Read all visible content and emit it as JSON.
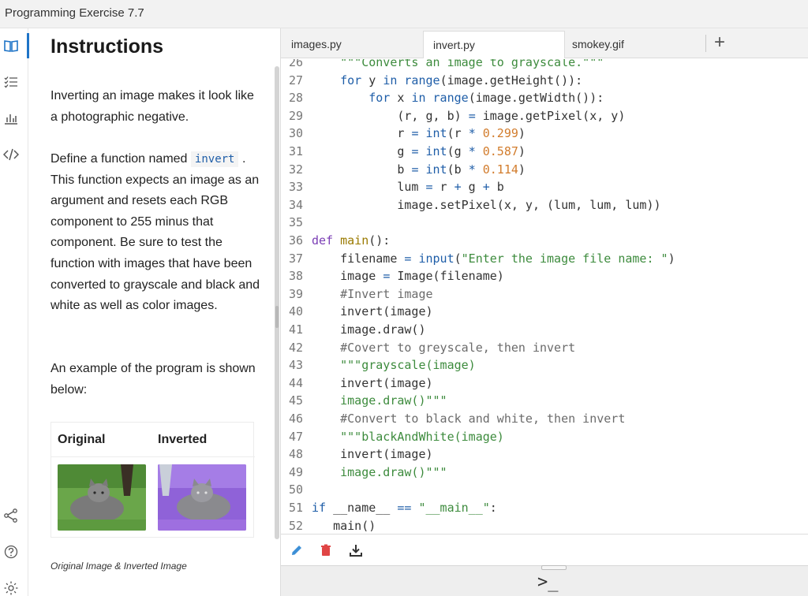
{
  "window": {
    "title": "Programming Exercise 7.7"
  },
  "rail": {
    "icons": [
      "book-icon",
      "checklist-icon",
      "chart-icon",
      "code-icon",
      "share-icon",
      "help-icon",
      "settings-icon"
    ]
  },
  "instructions": {
    "heading": "Instructions",
    "para1": "Inverting an image makes it look like a photographic negative.",
    "para2_prefix": "Define a function named",
    "para2_code": "invert",
    "para2_rest": ". This function expects an image as an argument and resets each RGB component to 255 minus that component. Be sure to test the function with images that have been converted to grayscale and black and white as well as color images.",
    "para3": "An example of the program is shown below:",
    "table": {
      "col1": "Original",
      "col2": "Inverted"
    },
    "caption": "Original Image & Inverted Image"
  },
  "tabs": [
    {
      "label": "images.py",
      "active": false
    },
    {
      "label": "invert.py",
      "active": true
    },
    {
      "label": "smokey.gif",
      "active": false
    }
  ],
  "tab_add_label": "+",
  "code": {
    "lines": [
      {
        "n": "26",
        "text": "    \"\"\"Converts an image to grayscale.\"\"\""
      },
      {
        "n": "27",
        "text": "    for y in range(image.getHeight()):"
      },
      {
        "n": "28",
        "text": "        for x in range(image.getWidth()):"
      },
      {
        "n": "29",
        "text": "            (r, g, b) = image.getPixel(x, y)"
      },
      {
        "n": "30",
        "text": "            r = int(r * 0.299)"
      },
      {
        "n": "31",
        "text": "            g = int(g * 0.587)"
      },
      {
        "n": "32",
        "text": "            b = int(b * 0.114)"
      },
      {
        "n": "33",
        "text": "            lum = r + g + b"
      },
      {
        "n": "34",
        "text": "            image.setPixel(x, y, (lum, lum, lum))"
      },
      {
        "n": "35",
        "text": ""
      },
      {
        "n": "36",
        "text": "def main():"
      },
      {
        "n": "37",
        "text": "    filename = input(\"Enter the image file name: \")"
      },
      {
        "n": "38",
        "text": "    image = Image(filename)"
      },
      {
        "n": "39",
        "text": "    #Invert image"
      },
      {
        "n": "40",
        "text": "    invert(image)"
      },
      {
        "n": "41",
        "text": "    image.draw()"
      },
      {
        "n": "42",
        "text": "    #Covert to greyscale, then invert"
      },
      {
        "n": "43",
        "text": "    \"\"\"grayscale(image)"
      },
      {
        "n": "44",
        "text": "    invert(image)"
      },
      {
        "n": "45",
        "text": "    image.draw()\"\"\""
      },
      {
        "n": "46",
        "text": "    #Convert to black and white, then invert"
      },
      {
        "n": "47",
        "text": "    \"\"\"blackAndWhite(image)"
      },
      {
        "n": "48",
        "text": "    invert(image)"
      },
      {
        "n": "49",
        "text": "    image.draw()\"\"\""
      },
      {
        "n": "50",
        "text": ""
      },
      {
        "n": "51",
        "text": "if __name__ == \"__main__\":"
      },
      {
        "n": "52",
        "text": "   main()"
      }
    ]
  },
  "toolbar": {
    "icons": [
      "pencil-icon",
      "trash-icon",
      "download-icon"
    ]
  },
  "console": {
    "prompt": ">_"
  }
}
